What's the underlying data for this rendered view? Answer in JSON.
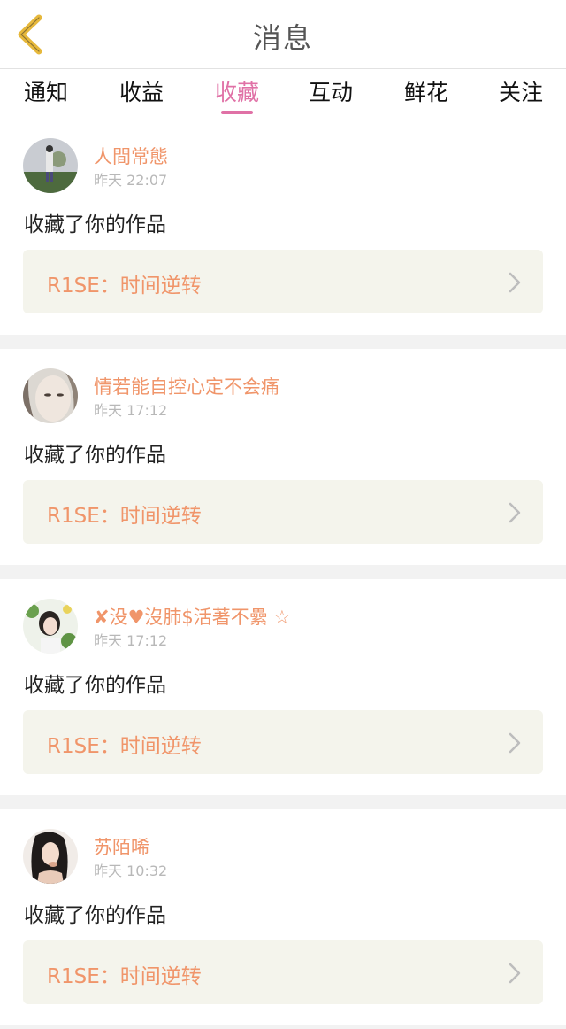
{
  "header": {
    "title": "消息",
    "back_icon": "chevron-left-icon",
    "back_color": "#e6b83c"
  },
  "tabs": [
    {
      "label": "通知",
      "active": false
    },
    {
      "label": "收益",
      "active": false
    },
    {
      "label": "收藏",
      "active": true
    },
    {
      "label": "互动",
      "active": false
    },
    {
      "label": "鲜花",
      "active": false
    },
    {
      "label": "关注",
      "active": false
    }
  ],
  "colors": {
    "accent": "#e071a6",
    "username": "#f0956a",
    "work_title": "#f0956a",
    "card_box": "#f4f4ec"
  },
  "items": [
    {
      "username": "人間常態",
      "time": "昨天 22:07",
      "action": "收藏了你的作品",
      "work_title": "R1SE：时间逆转"
    },
    {
      "username": "情若能自控心定不会痛",
      "time": "昨天 17:12",
      "action": "收藏了你的作品",
      "work_title": "R1SE：时间逆转"
    },
    {
      "username": "✘没♥沒肺$活著不纍 ☆",
      "time": "昨天 17:12",
      "action": "收藏了你的作品",
      "work_title": "R1SE：时间逆转"
    },
    {
      "username": "苏陌唏",
      "time": "昨天 10:32",
      "action": "收藏了你的作品",
      "work_title": "R1SE：时间逆转"
    }
  ]
}
